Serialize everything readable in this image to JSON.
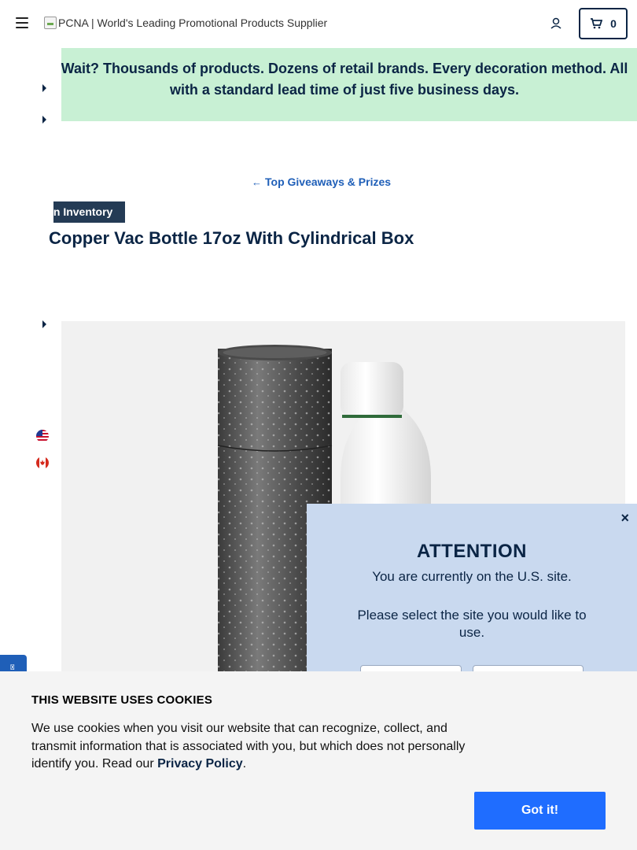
{
  "header": {
    "logo_alt": "PCNA | World's Leading Promotional Products Supplier",
    "cart_count": "0"
  },
  "promo": {
    "text": "Wait? Thousands of products. Dozens of retail brands. Every decoration method. All with a standard lead time of just five business days."
  },
  "breadcrumb": {
    "back_label": "Top Giveaways & Prizes"
  },
  "product": {
    "badge": "In Inventory",
    "title": "Copper Vac Bottle 17oz With Cylindrical Box"
  },
  "icons": {
    "menu": "hamburger-icon",
    "account": "user-icon",
    "cart": "cart-icon",
    "back": "arrow-left-icon",
    "close": "close-icon",
    "flag_us": "us-flag-icon",
    "flag_ca": "canada-flag-icon"
  },
  "attention": {
    "heading": "ATTENTION",
    "line1": "You are currently on the U.S. site.",
    "line2": "Please select the site you would like to use.",
    "close_label": "×"
  },
  "cookie": {
    "heading": "THIS WEBSITE USES COOKIES",
    "body": "We use cookies when you visit our website that can recognize, collect, and transmit information that is associated with you, but which does not personally identify you. Read our ",
    "link": "Privacy Policy",
    "suffix": ".",
    "button": "Got it!"
  },
  "colors": {
    "navy": "#0b2545",
    "promo_bg": "#c8f0d4",
    "modal_bg": "#c9d9ef",
    "accent_blue": "#1f6dff",
    "link_blue": "#1f5fb8"
  }
}
